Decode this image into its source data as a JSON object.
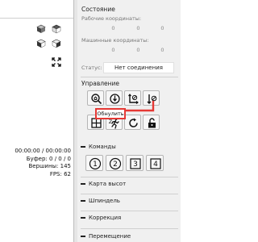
{
  "viewer": {
    "time": "00:00:00 / 00:00:00",
    "buffer": "Буфер: 0 / 0 / 0",
    "vertices": "Вершины: 145",
    "fps": "FPS: 62"
  },
  "state": {
    "title": "Состояние",
    "work_coords_label": "Рабочие координаты:",
    "work_coords": [
      "0",
      "0",
      "0"
    ],
    "machine_coords_label": "Машинные координаты:",
    "machine_coords": [
      "0",
      "0",
      "0"
    ],
    "status_label": "Статус:",
    "status_value": "Нет соединения"
  },
  "control": {
    "title": "Управление",
    "tooltip": "Обнулить Z"
  },
  "commands": {
    "title": "Команды",
    "buttons": [
      "1",
      "2",
      "3",
      "4"
    ]
  },
  "sections": {
    "heightmap": "Карта высот",
    "spindle": "Шпиндель",
    "correction": "Коррекция",
    "jog": "Перемещение"
  }
}
